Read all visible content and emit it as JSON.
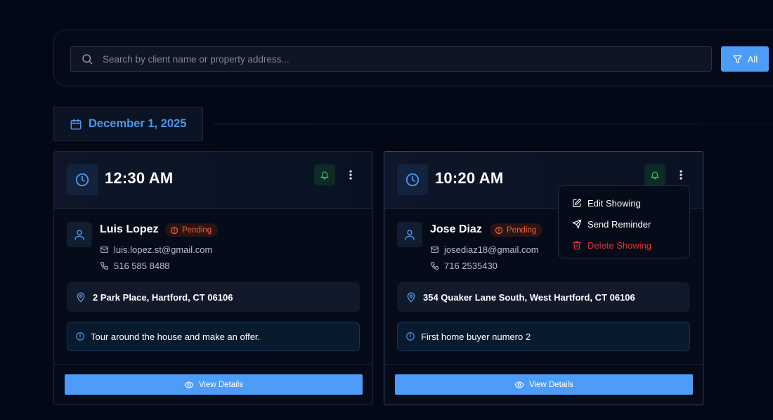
{
  "search": {
    "placeholder": "Search by client name or property address...",
    "filter_label": "All"
  },
  "date_header": {
    "label": "December 1, 2025"
  },
  "showings": [
    {
      "time": "12:30 AM",
      "client_name": "Luis Lopez",
      "status": "Pending",
      "email": "luis.lopez.st@gmail.com",
      "phone": "516 585 8488",
      "address": "2 Park Place, Hartford, CT 06106",
      "note": "Tour around the house and make an offer.",
      "view_label": "View Details"
    },
    {
      "time": "10:20 AM",
      "client_name": "Jose Diaz",
      "status": "Pending",
      "email": "josediaz18@gmail.com",
      "phone": "716 2535430",
      "address": "354 Quaker Lane South, West Hartford, CT 06106",
      "note": "First home buyer numero 2",
      "view_label": "View Details"
    }
  ],
  "menu": {
    "items": [
      {
        "label": "Edit Showing",
        "icon": "edit-icon"
      },
      {
        "label": "Send Reminder",
        "icon": "send-icon"
      },
      {
        "label": "Delete Showing",
        "icon": "trash-icon",
        "danger": true
      }
    ]
  },
  "colors": {
    "accent": "#4c9cf8",
    "date_text": "#4f97ec",
    "pending": "#f2633a",
    "bell": "#22c55e",
    "danger": "#e0333b",
    "background": "#030816"
  }
}
